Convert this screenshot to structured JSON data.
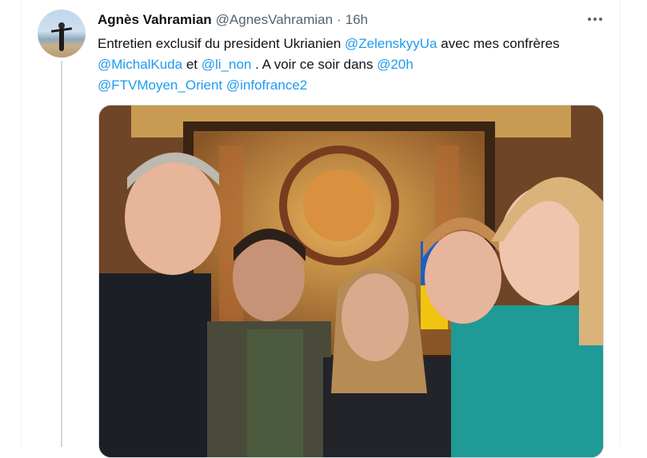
{
  "tweet": {
    "author_name": "Agnès Vahramian",
    "author_handle": "@AgnesVahramian",
    "separator": "·",
    "timestamp": "16h",
    "text_segments": [
      {
        "text": "Entretien exclusif du president Ukrianien ",
        "type": "plain"
      },
      {
        "text": "@ZelenskyyUa",
        "type": "mention"
      },
      {
        "text": " avec mes confrères ",
        "type": "plain"
      },
      {
        "text": "@MichalKuda",
        "type": "mention"
      },
      {
        "text": " et ",
        "type": "plain"
      },
      {
        "text": "@li_non",
        "type": "mention"
      },
      {
        "text": " . A voir ce soir dans ",
        "type": "plain"
      },
      {
        "text": "@20h",
        "type": "mention"
      },
      {
        "text": " ",
        "type": "plain"
      },
      {
        "text": "@FTVMoyen_Orient",
        "type": "mention"
      },
      {
        "text": " ",
        "type": "plain"
      },
      {
        "text": "@infofrance2",
        "type": "mention"
      }
    ]
  },
  "icons": {
    "more": "more-horizontal-icon"
  },
  "colors": {
    "link": "#1d9bf0",
    "text": "#0f1419",
    "secondary": "#536471",
    "border": "#eff3f4"
  }
}
